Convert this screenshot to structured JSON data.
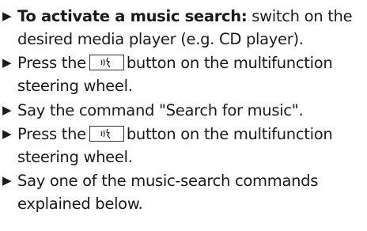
{
  "steps": [
    {
      "bold_lead": "To activate a music search:",
      "line1_rest": " switch on the",
      "line2": "desired media player (e.g. CD player)."
    },
    {
      "line1_before": "Press the",
      "line1_after": "button on the multifunction",
      "line2": "steering wheel.",
      "key_icon": "voice-control-icon"
    },
    {
      "line1": "Say the command \"Search for music\"."
    },
    {
      "line1_before": "Press the",
      "line1_after": "button on the multifunction",
      "line2": "steering wheel.",
      "key_icon": "voice-control-icon"
    },
    {
      "line1": "Say one of the music-search commands",
      "line2": "explained below."
    }
  ],
  "bullet_glyph": "▶"
}
